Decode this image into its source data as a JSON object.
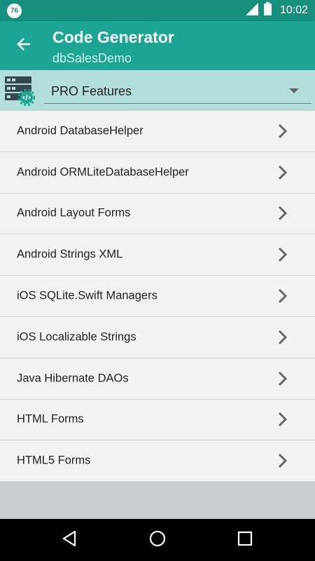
{
  "status": {
    "badge": "76",
    "time": "10:02",
    "icons": [
      "signal-icon",
      "battery-icon"
    ]
  },
  "header": {
    "title": "Code Generator",
    "subtitle": "dbSalesDemo",
    "back_icon": "back-arrow-icon"
  },
  "selector": {
    "icon": "database-settings-icon",
    "selected": "PRO Features"
  },
  "items": [
    {
      "label": "Android DatabaseHelper"
    },
    {
      "label": "Android ORMLiteDatabaseHelper"
    },
    {
      "label": "Android Layout Forms"
    },
    {
      "label": "Android Strings XML"
    },
    {
      "label": "iOS SQLite.Swift Managers"
    },
    {
      "label": "iOS Localizable Strings"
    },
    {
      "label": "Java Hibernate DAOs"
    },
    {
      "label": "HTML Forms"
    },
    {
      "label": "HTML5 Forms"
    }
  ],
  "navigation": {
    "buttons": [
      "back-triangle-icon",
      "home-circle-icon",
      "recents-square-icon"
    ]
  },
  "colors": {
    "status_bar": "#168f7d",
    "app_bar": "#1aa594",
    "selector_bar": "#b2dfdb",
    "list_bg": "#f2f2f2"
  }
}
